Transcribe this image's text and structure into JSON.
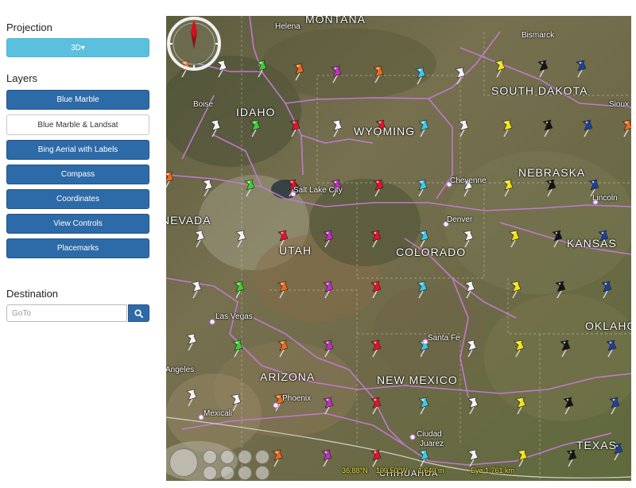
{
  "sidebar": {
    "projection_heading": "Projection",
    "projection_button": "3D▾",
    "layers_heading": "Layers",
    "layers": [
      {
        "label": "Blue Marble",
        "active": true
      },
      {
        "label": "Blue Marble & Landsat",
        "active": false
      },
      {
        "label": "Bing Aerial with Labels",
        "active": true
      },
      {
        "label": "Compass",
        "active": true
      },
      {
        "label": "Coordinates",
        "active": true
      },
      {
        "label": "View Controls",
        "active": true
      },
      {
        "label": "Placemarks",
        "active": true
      }
    ],
    "destination_heading": "Destination",
    "goto_placeholder": "GoTo",
    "goto_button_icon": "search-icon"
  },
  "map": {
    "states": [
      "MONTANA",
      "IDAHO",
      "WYOMING",
      "SOUTH DAKOTA",
      "NEBRASKA",
      "NEVADA",
      "UTAH",
      "COLORADO",
      "KANSAS",
      "ARIZONA",
      "NEW MEXICO",
      "OKLAHOMA",
      "TEXAS",
      "CHIHUAHUA"
    ],
    "cities": [
      "Helena",
      "Bismarck",
      "Boise",
      "Sioux",
      "Salt Lake City",
      "Cheyenne",
      "Lincoln",
      "Denver",
      "Las Vegas",
      "Santa Fe",
      "Angeles",
      "Phoenix",
      "Mexicali",
      "Ciudad",
      "Juarez"
    ],
    "coordinates": {
      "lat": "36.88°N",
      "lon": "109.50°W",
      "altitude": "1,640 m",
      "eye": "Eye  1,761 km"
    },
    "colors": {
      "terrain": "#6b6a4c",
      "border": "#c47ad6",
      "pin_red": "#e8122a",
      "pin_yellow": "#f2e21a",
      "pin_magenta": "#c02fc0",
      "pin_cyan": "#3fc8e8",
      "pin_blue": "#1e3f9e",
      "pin_white": "#f4f4f4",
      "pin_black": "#141414",
      "pin_green": "#3ccf2e",
      "pin_orange": "#ef6a1c",
      "compass_needle": "#d4101a"
    }
  }
}
